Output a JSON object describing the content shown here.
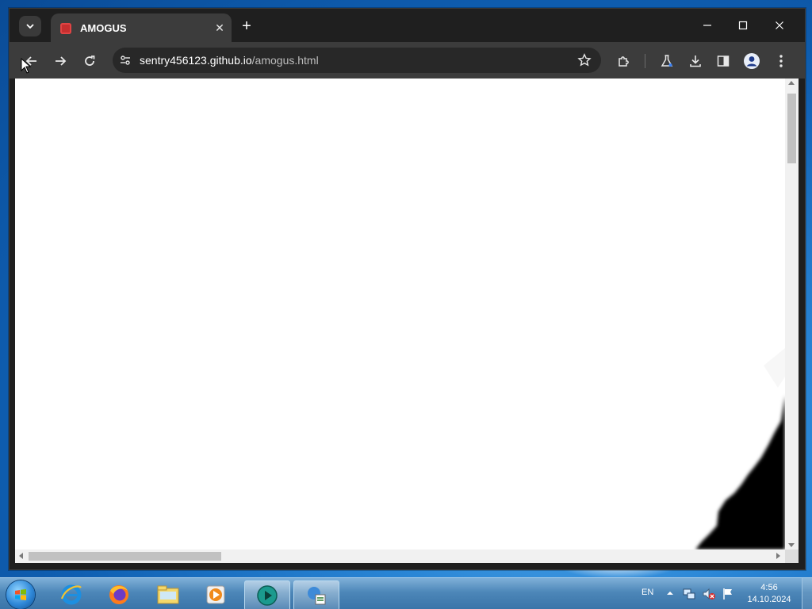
{
  "browser": {
    "tab": {
      "title": "AMOGUS",
      "close": "✕"
    },
    "new_tab": "+",
    "window_controls": {
      "minimize": "—",
      "maximize": "☐",
      "close": "✕"
    },
    "address": {
      "host": "sentry456123.github.io",
      "path": "/amogus.html"
    }
  },
  "taskbar": {
    "language": "EN",
    "clock_time": "4:56",
    "clock_date": "14.10.2024",
    "items": [
      {
        "name": "internet-explorer"
      },
      {
        "name": "firefox"
      },
      {
        "name": "file-explorer"
      },
      {
        "name": "media-player"
      },
      {
        "name": "chrome-app"
      },
      {
        "name": "network-tool"
      }
    ]
  },
  "colors": {
    "browser_frame": "#1f1f1f",
    "toolbar": "#3c3c3c",
    "omnibox": "#282828",
    "page_bg": "#ffffff",
    "taskbar_top": "#7fb0d8",
    "taskbar_bottom": "#3a74a8"
  }
}
